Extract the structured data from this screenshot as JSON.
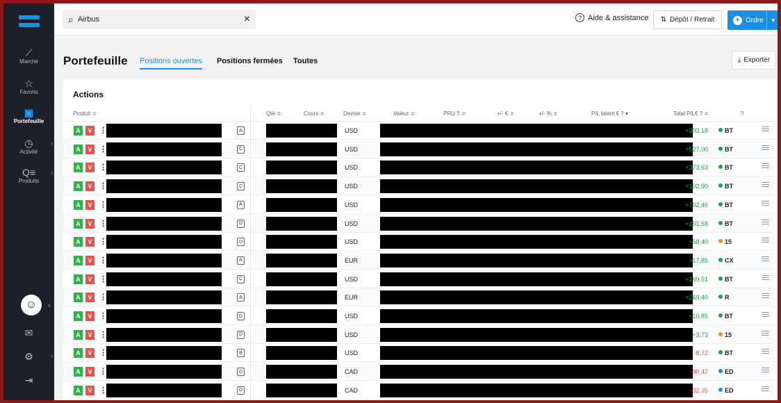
{
  "sidebar": {
    "items": [
      {
        "label": "Marché",
        "icon": "chart-line-icon"
      },
      {
        "label": "Favoris",
        "icon": "star-icon"
      },
      {
        "label": "Portefeuille",
        "icon": "wallet-icon"
      },
      {
        "label": "Activité",
        "icon": "clock-icon"
      },
      {
        "label": "Produits",
        "icon": "search-list-icon"
      }
    ],
    "active": "Portefeuille"
  },
  "topbar": {
    "search_value": "Airbus",
    "help_label": "Aide & assistance",
    "depot_label": "Dépôt / Retrait",
    "ordre_label": "Ordre"
  },
  "page": {
    "title": "Portefeuille",
    "tabs": [
      "Positions ouvertes",
      "Positions fermées",
      "Toutes"
    ],
    "active_tab": "Positions ouvertes",
    "export_label": "Exporter"
  },
  "table": {
    "section_title": "Actions",
    "headers": {
      "produit": "Produit ≑",
      "qte": "Qté ≑",
      "cours": "Cours ≑",
      "devise": "Devise ≑",
      "valeur": "Valeur ≑",
      "pru": "PRU ? ≑",
      "pm_eur": "+/- € ≑",
      "pm_pct": "+/- % ≑",
      "pl_latent": "P/L latent € ? ▾",
      "total_pl": "Total P/L€ ? ≑",
      "info": "?"
    },
    "buy_label": "A",
    "sell_label": "V",
    "rows": [
      {
        "type": "A",
        "currency": "USD",
        "pl": "+393,18",
        "tag": "BT",
        "tag_color": "#22a145",
        "sign": "pos"
      },
      {
        "type": "C",
        "currency": "USD",
        "pl": "+527,00",
        "tag": "BT",
        "tag_color": "#22a145",
        "sign": "pos"
      },
      {
        "type": "C",
        "currency": "USD",
        "pl": "+373,63",
        "tag": "BT",
        "tag_color": "#22a145",
        "sign": "pos"
      },
      {
        "type": "C",
        "currency": "USD",
        "pl": "+102,90",
        "tag": "BT",
        "tag_color": "#22a145",
        "sign": "pos"
      },
      {
        "type": "A",
        "currency": "USD",
        "pl": "+702,46",
        "tag": "BT",
        "tag_color": "#22a145",
        "sign": "pos"
      },
      {
        "type": "D",
        "currency": "USD",
        "pl": "+101,58",
        "tag": "BT",
        "tag_color": "#22a145",
        "sign": "pos"
      },
      {
        "type": "D",
        "currency": "USD",
        "pl": "+58,40",
        "tag": "15",
        "tag_color": "#f0901e",
        "sign": "pos"
      },
      {
        "type": "A",
        "currency": "EUR",
        "pl": "+17,85",
        "tag": "CX",
        "tag_color": "#22a145",
        "sign": "pos"
      },
      {
        "type": "C",
        "currency": "USD",
        "pl": "+169,51",
        "tag": "BT",
        "tag_color": "#22a145",
        "sign": "pos"
      },
      {
        "type": "A",
        "currency": "EUR",
        "pl": "+269,40",
        "tag": "R",
        "tag_color": "#22a145",
        "sign": "pos"
      },
      {
        "type": "D",
        "currency": "USD",
        "pl": "+10,85",
        "tag": "BT",
        "tag_color": "#22a145",
        "sign": "pos"
      },
      {
        "type": "D",
        "currency": "USD",
        "pl": "+3,73",
        "tag": "15",
        "tag_color": "#f0901e",
        "sign": "pos"
      },
      {
        "type": "B",
        "currency": "USD",
        "pl": "-8,72",
        "tag": "BT",
        "tag_color": "#22a145",
        "sign": "neg"
      },
      {
        "type": "D",
        "currency": "CAD",
        "pl": "-90,47",
        "tag": "ED",
        "tag_color": "#1d8fe0",
        "sign": "neg"
      },
      {
        "type": "D",
        "currency": "CAD",
        "pl": "-32,35",
        "tag": "ED",
        "tag_color": "#1d8fe0",
        "sign": "neg"
      }
    ]
  }
}
